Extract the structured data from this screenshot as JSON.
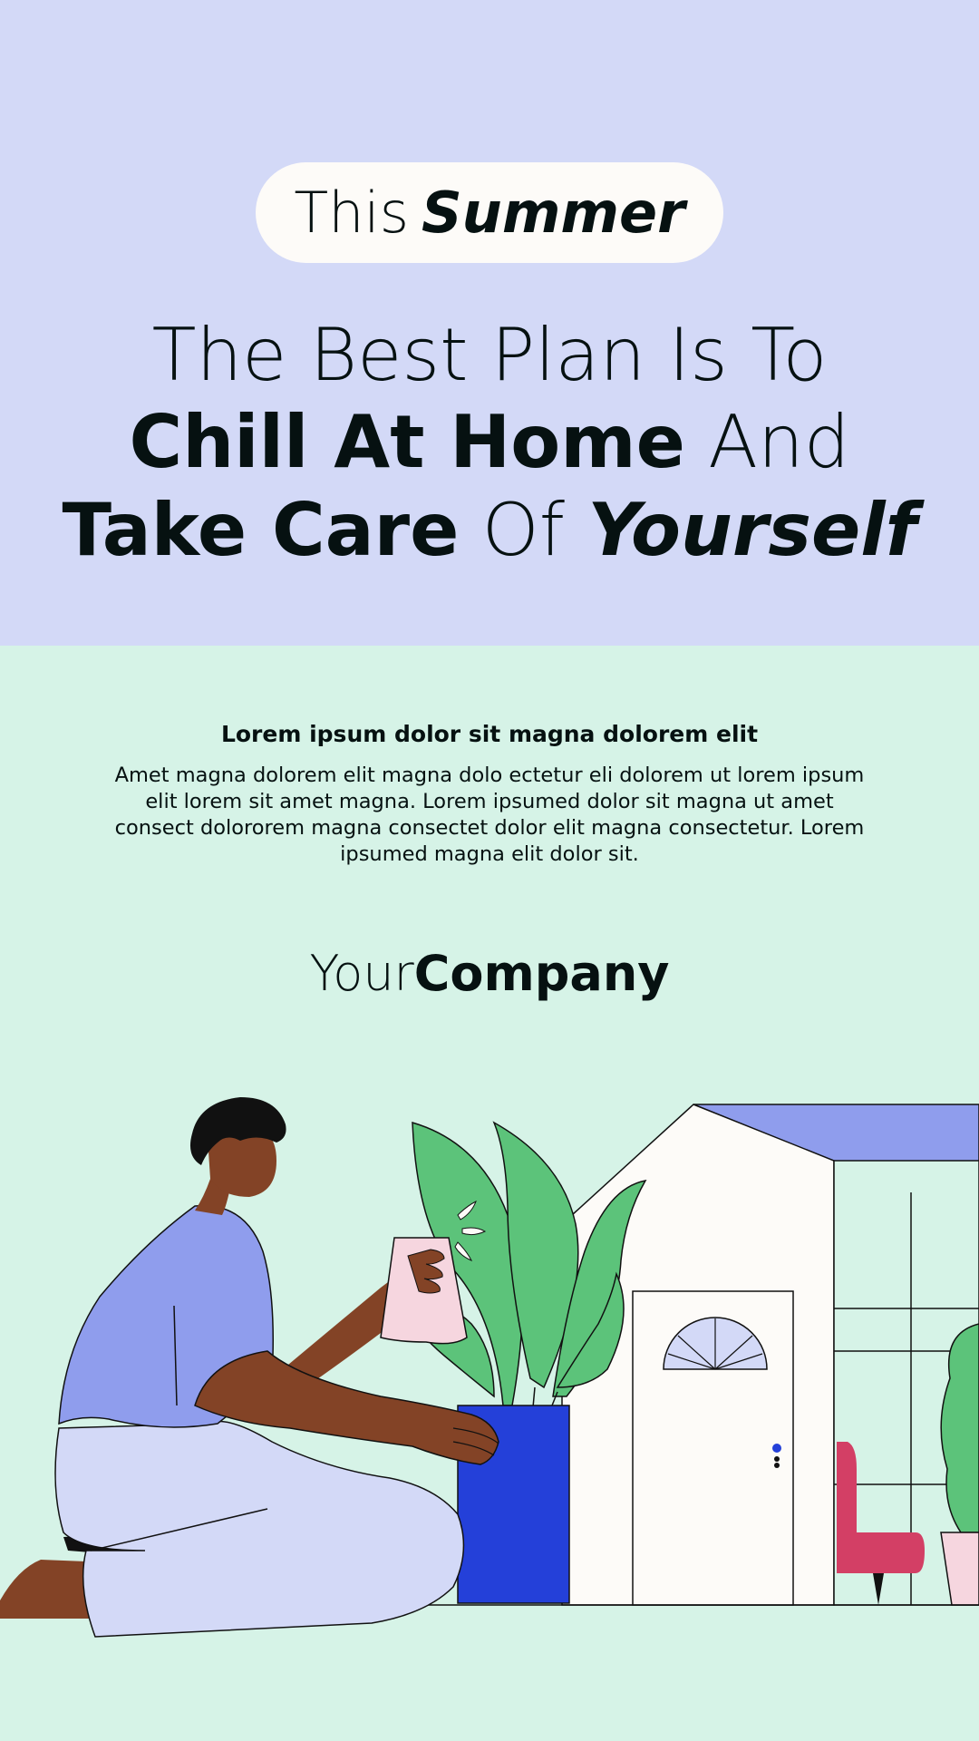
{
  "pill": {
    "light": "This",
    "bold": "Summer"
  },
  "headline": {
    "line1": "The Best Plan Is To",
    "line2_bold": "Chill At Home",
    "line2_light": "And",
    "line3_bold": "Take Care",
    "line3_light": "Of",
    "line3_italic": "Yourself"
  },
  "subheading": "Lorem ipsum dolor sit magna dolorem elit",
  "paragraph": "Amet magna dolorem elit magna dolo ectetur eli dolorem ut lorem ipsum elit lorem sit amet magna. Lorem ipsumed dolor sit magna ut amet consect dolororem magna consectet dolor elit magna consectetur. Lorem ipsumed magna elit dolor sit.",
  "company": {
    "light": "Your",
    "bold": "Company"
  },
  "colors": {
    "top_bg": "#d3d9f7",
    "bottom_bg": "#d6f3e7",
    "text": "#061111",
    "shirt": "#8f9ded",
    "pot": "#2440d9",
    "leaf": "#5cc37a",
    "skin": "#834326",
    "chair": "#d33f65"
  }
}
